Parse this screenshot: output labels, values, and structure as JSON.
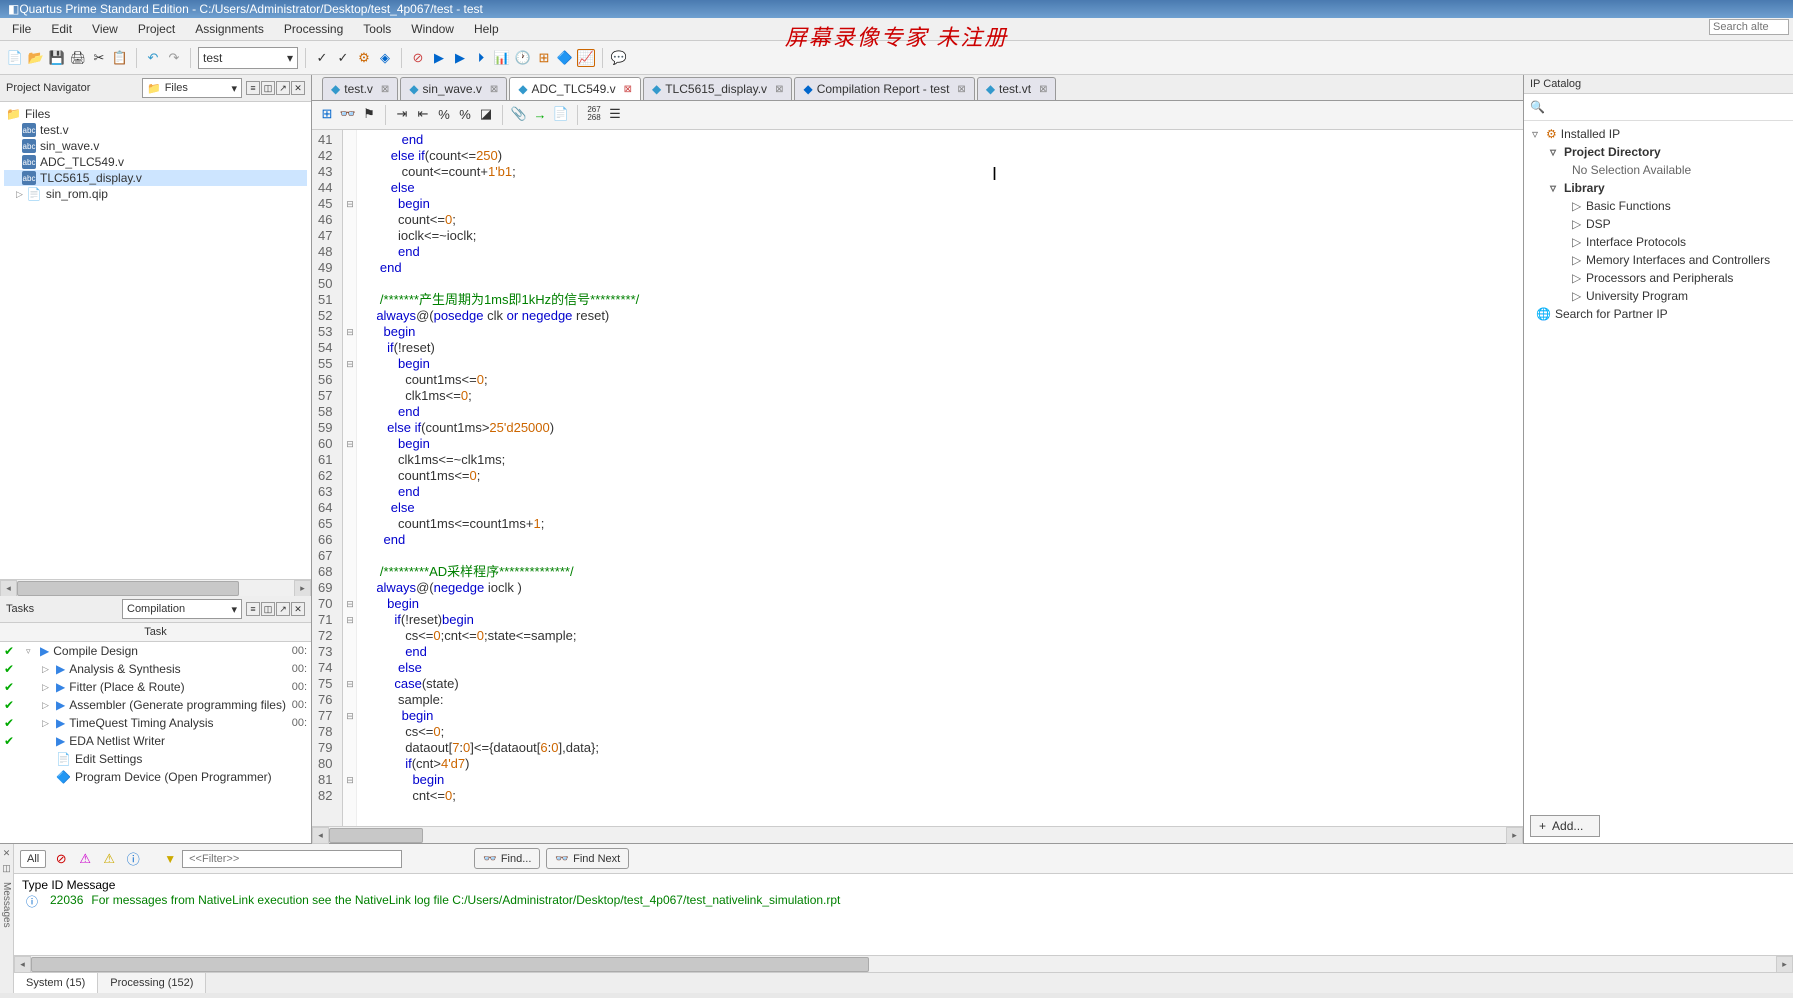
{
  "title": "Quartus Prime Standard Edition - C:/Users/Administrator/Desktop/test_4p067/test - test",
  "menu": [
    "File",
    "Edit",
    "View",
    "Project",
    "Assignments",
    "Processing",
    "Tools",
    "Window",
    "Help"
  ],
  "watermark": "屏幕录像专家  未注册",
  "search_placeholder": "Search alte",
  "toolbar_combo": "test",
  "nav": {
    "title": "Project Navigator",
    "filter": "Files",
    "root": "Files",
    "files": [
      "test.v",
      "sin_wave.v",
      "ADC_TLC549.v",
      "TLC5615_display.v",
      "sin_rom.qip"
    ]
  },
  "tasks": {
    "title": "Tasks",
    "filter": "Compilation",
    "header": "Task",
    "rows": [
      {
        "ok": true,
        "exp": "▿",
        "icon": "▶",
        "label": "Compile Design",
        "time": "00:"
      },
      {
        "ok": true,
        "exp": "▷",
        "icon": "▶",
        "label": "Analysis & Synthesis",
        "time": "00:",
        "indent": 1
      },
      {
        "ok": true,
        "exp": "▷",
        "icon": "▶",
        "label": "Fitter (Place & Route)",
        "time": "00:",
        "indent": 1
      },
      {
        "ok": true,
        "exp": "▷",
        "icon": "▶",
        "label": "Assembler (Generate programming files)",
        "time": "00:",
        "indent": 1
      },
      {
        "ok": true,
        "exp": "▷",
        "icon": "▶",
        "label": "TimeQuest Timing Analysis",
        "time": "00:",
        "indent": 1
      },
      {
        "ok": true,
        "exp": "",
        "icon": "▶",
        "label": "EDA Netlist Writer",
        "time": "",
        "indent": 1
      },
      {
        "ok": false,
        "exp": "",
        "icon": "📄",
        "label": "Edit Settings",
        "time": "",
        "indent": 1
      },
      {
        "ok": false,
        "exp": "",
        "icon": "🔷",
        "label": "Program Device (Open Programmer)",
        "time": "",
        "indent": 1
      }
    ]
  },
  "tabs": [
    {
      "label": "test.v",
      "active": false,
      "close": "gray"
    },
    {
      "label": "sin_wave.v",
      "active": false,
      "close": "gray"
    },
    {
      "label": "ADC_TLC549.v",
      "active": true,
      "close": "red"
    },
    {
      "label": "TLC5615_display.v",
      "active": false,
      "close": "gray"
    },
    {
      "label": "Compilation Report - test",
      "active": false,
      "close": "gray",
      "comp": true
    },
    {
      "label": "test.vt",
      "active": false,
      "close": "gray"
    }
  ],
  "code": {
    "start": 41,
    "lines": [
      "          end",
      "       else if(count<=250)",
      "          count<=count+1'b1;",
      "       else",
      "         begin",
      "         count<=0;",
      "         ioclk<=~ioclk;",
      "         end",
      "    end",
      "",
      "    /*******产生周期为1ms即1kHz的信号*********/",
      "   always@(posedge clk or negedge reset)",
      "     begin",
      "      if(!reset)",
      "         begin",
      "           count1ms<=0;",
      "           clk1ms<=0;",
      "         end",
      "      else if(count1ms>25'd25000)",
      "         begin",
      "         clk1ms<=~clk1ms;",
      "         count1ms<=0;",
      "         end",
      "       else",
      "         count1ms<=count1ms+1;",
      "     end",
      "",
      "    /*********AD采样程序**************/",
      "   always@(negedge ioclk )",
      "      begin",
      "        if(!reset)begin",
      "           cs<=0;cnt<=0;state<=sample;",
      "           end",
      "         else",
      "        case(state)",
      "         sample:",
      "          begin",
      "           cs<=0;",
      "           dataout[7:0]<={dataout[6:0],data};",
      "           if(cnt>4'd7)",
      "             begin",
      "             cnt<=0;"
    ]
  },
  "ip": {
    "title": "IP Catalog",
    "root": "Installed IP",
    "proj": "Project Directory",
    "nosel": "No Selection Available",
    "lib": "Library",
    "cats": [
      "Basic Functions",
      "DSP",
      "Interface Protocols",
      "Memory Interfaces and Controllers",
      "Processors and Peripherals",
      "University Program"
    ],
    "search": "Search for Partner IP",
    "add": "Add..."
  },
  "messages": {
    "filter_ph": "<<Filter>>",
    "find": "Find...",
    "findnext": "Find Next",
    "all": "All",
    "cols": "Type   ID    Message",
    "row": {
      "id": "22036",
      "text": "For messages from NativeLink execution see the NativeLink log file C:/Users/Administrator/Desktop/test_4p067/test_nativelink_simulation.rpt"
    },
    "tabs": [
      "System (15)",
      "Processing (152)"
    ],
    "side": "Messages"
  }
}
